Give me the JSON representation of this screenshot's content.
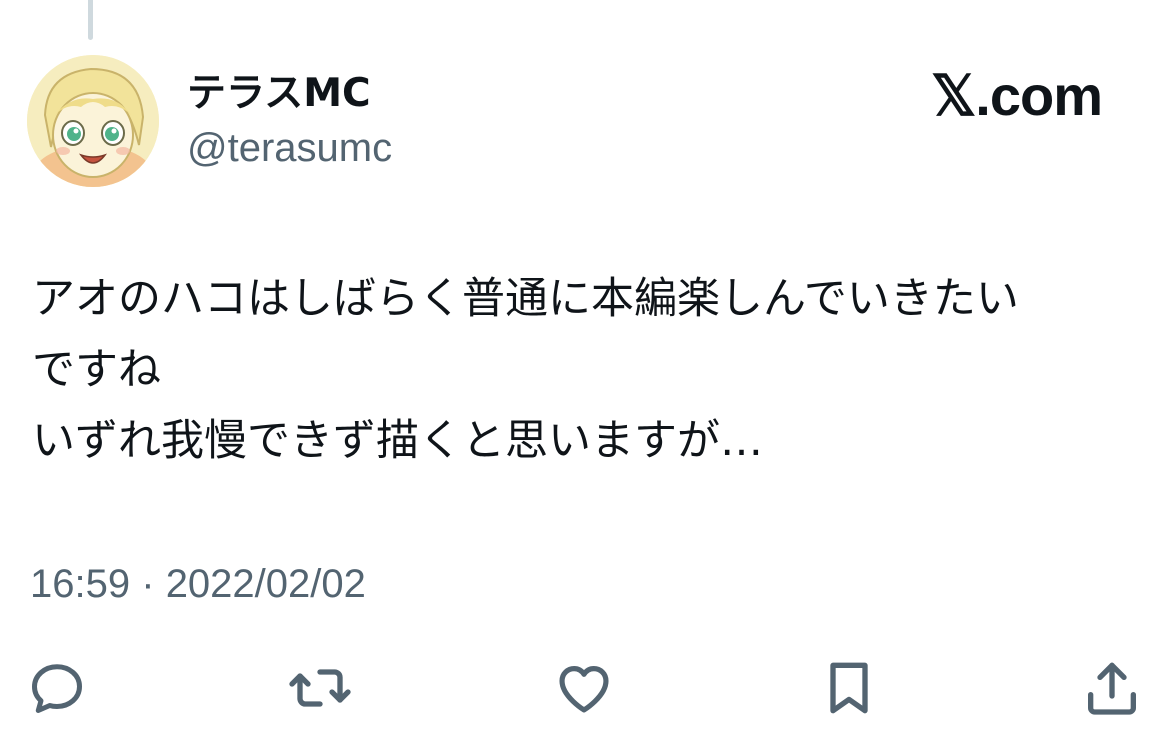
{
  "tweet": {
    "display_name": "テラスMC",
    "handle": "@terasumc",
    "brand": "𝕏.com",
    "body_lines": [
      "アオのハコはしばらく普通に本編楽しんでいきたい",
      "ですね",
      "いずれ我慢できず描くと思いますが…"
    ],
    "time": "16:59",
    "separator": "·",
    "date": "2022/02/02"
  },
  "actions": [
    {
      "name": "reply",
      "icon": "speech-bubble-icon"
    },
    {
      "name": "repost",
      "icon": "retweet-icon"
    },
    {
      "name": "like",
      "icon": "heart-icon"
    },
    {
      "name": "bookmark",
      "icon": "bookmark-icon"
    },
    {
      "name": "share",
      "icon": "share-upload-icon"
    }
  ],
  "colors": {
    "text_primary": "#0f1419",
    "text_secondary": "#536471",
    "thread_line": "#cfd9de",
    "icon": "#536471"
  }
}
